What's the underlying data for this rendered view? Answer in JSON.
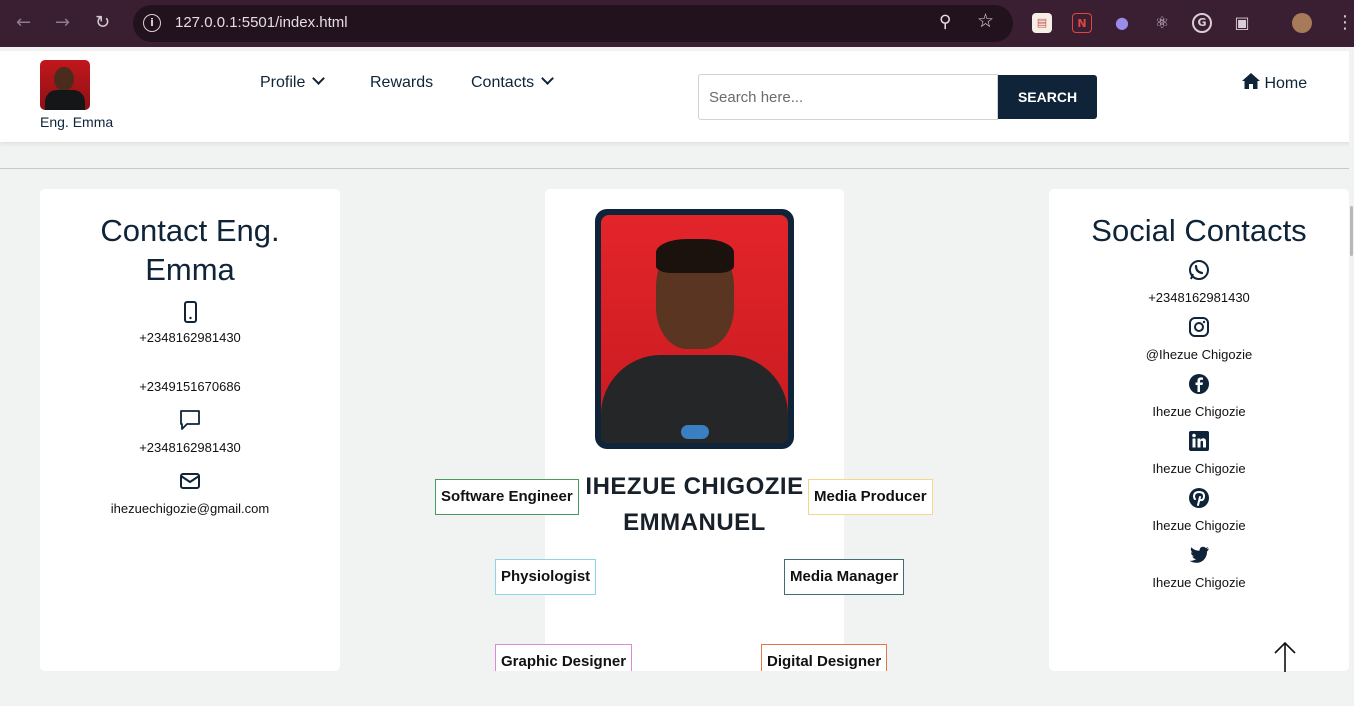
{
  "browser": {
    "url": "127.0.0.1:5501/index.html",
    "back_icon": "←",
    "forward_icon": "→",
    "reload_icon": "↻",
    "menu_icon": "⋮"
  },
  "header": {
    "brand": "Eng. Emma",
    "nav": {
      "profile": "Profile",
      "rewards": "Rewards",
      "contacts": "Contacts",
      "home": "Home"
    },
    "search": {
      "placeholder": "Search here...",
      "button": "SEARCH"
    }
  },
  "contact_card": {
    "title": "Contact Eng. Emma",
    "phone1": "+2348162981430",
    "phone2": "+2349151670686",
    "message": "+2348162981430",
    "email": "ihezuechigozie@gmail.com"
  },
  "profile": {
    "name_line1": "IHEZUE CHIGOZIE",
    "name_line2": "EMMANUEL",
    "roles": {
      "software_engineer": "Software Engineer",
      "media_producer": "Media Producer",
      "physiologist": "Physiologist",
      "media_manager": "Media Manager",
      "graphic_designer": "Graphic Designer",
      "digital_designer": "Digital Designer"
    }
  },
  "social_card": {
    "title": "Social Contacts",
    "whatsapp": "+2348162981430",
    "instagram": "@Ihezue Chigozie",
    "facebook": "Ihezue Chigozie",
    "linkedin": "Ihezue Chigozie",
    "pinterest": "Ihezue Chigozie",
    "twitter": "Ihezue Chigozie"
  },
  "colors": {
    "primary": "#0f2438",
    "browser_frame": "#3a1f33",
    "page_background": "#f1f3f2",
    "role_software_engineer_border": "#4a9a5a",
    "role_media_producer_border": "#f2d98a",
    "role_physiologist_border": "#8fd3e6",
    "role_media_manager_border": "#3f6e73",
    "role_graphic_designer_border": "#d98ad9",
    "role_digital_designer_border": "#e0784a"
  }
}
